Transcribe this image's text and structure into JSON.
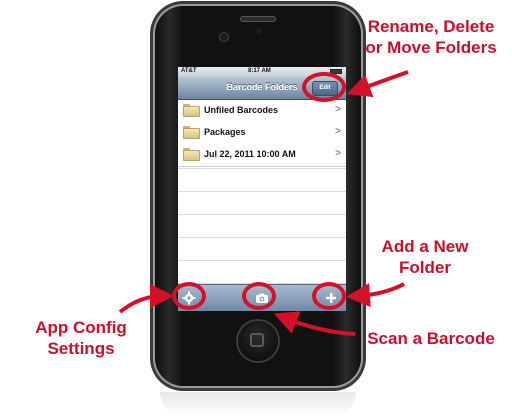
{
  "status_bar": {
    "carrier": "AT&T",
    "time": "8:17 AM"
  },
  "nav": {
    "title": "Barcode Folders",
    "edit_label": "Edit"
  },
  "folders": [
    {
      "label": "Unfiled Barcodes"
    },
    {
      "label": "Packages"
    },
    {
      "label": "Jul 22, 2011 10:00 AM"
    }
  ],
  "toolbar": {
    "settings_icon": "gear-icon",
    "scan_icon": "camera-icon",
    "add_icon": "plus-icon"
  },
  "annotations": {
    "edit": "Rename, Delete\nor Move Folders",
    "add": "Add a New\nFolder",
    "settings": "App Config\nSettings",
    "scan": "Scan a Barcode"
  },
  "colors": {
    "annotation": "#d3122a",
    "nav_bar": "#8ea0b8",
    "toolbar": "#7f95b2"
  }
}
